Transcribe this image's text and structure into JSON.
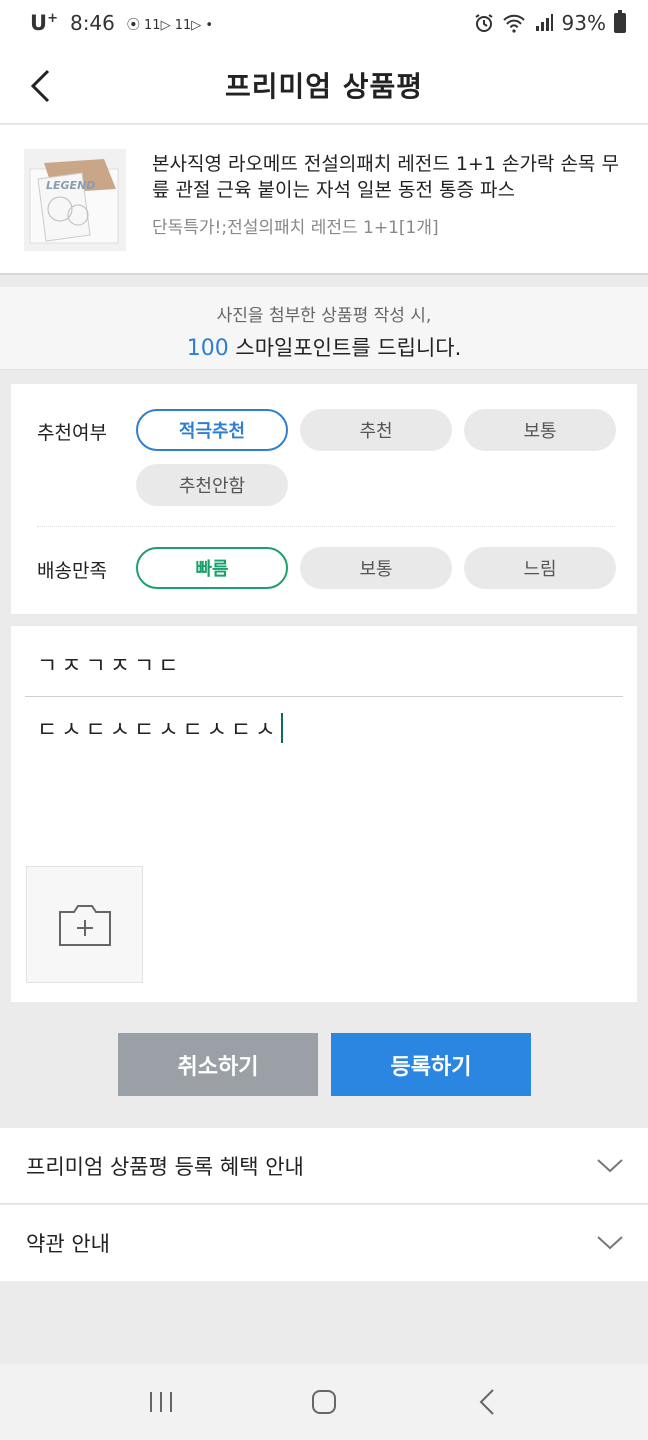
{
  "status_bar": {
    "carrier": "U",
    "carrier_sup": "+",
    "time": "8:46",
    "notif_icons": "⦿ 11▷ 11▷ •",
    "battery": "93%"
  },
  "header": {
    "title": "프리미엄 상품평"
  },
  "product": {
    "title": "본사직영 라오메뜨 전설의패치 레전드 1+1 손가락 손목 무릎 관절 근육 붙이는 자석 일본 동전 통증 파스",
    "option": "단독특가!;전설의패치 레전드 1+1[1개]",
    "thumb_text": "LEGEND"
  },
  "promo": {
    "line1": "사진을 첨부한 상품평 작성 시,",
    "point": "100",
    "line2_rest": "스마일포인트를 드립니다."
  },
  "recommend": {
    "label": "추천여부",
    "options": [
      "적극추천",
      "추천",
      "보통",
      "추천안함"
    ],
    "selected": "적극추천"
  },
  "delivery": {
    "label": "배송만족",
    "options": [
      "빠름",
      "보통",
      "느림"
    ],
    "selected": "빠름"
  },
  "review": {
    "title_value": "ㄱㅈㄱㅈㄱㄷ",
    "body_value": "ㄷㅅㄷㅅㄷㅅㄷㅅㄷㅅ"
  },
  "buttons": {
    "cancel": "취소하기",
    "submit": "등록하기"
  },
  "info": {
    "benefit": "프리미엄 상품평 등록 혜택 안내",
    "terms": "약관 안내"
  },
  "colors": {
    "blue_accent": "#2f7fd1",
    "green_accent": "#1aa06a",
    "submit_bg": "#2a86e0",
    "cancel_bg": "#9aa0a6"
  }
}
